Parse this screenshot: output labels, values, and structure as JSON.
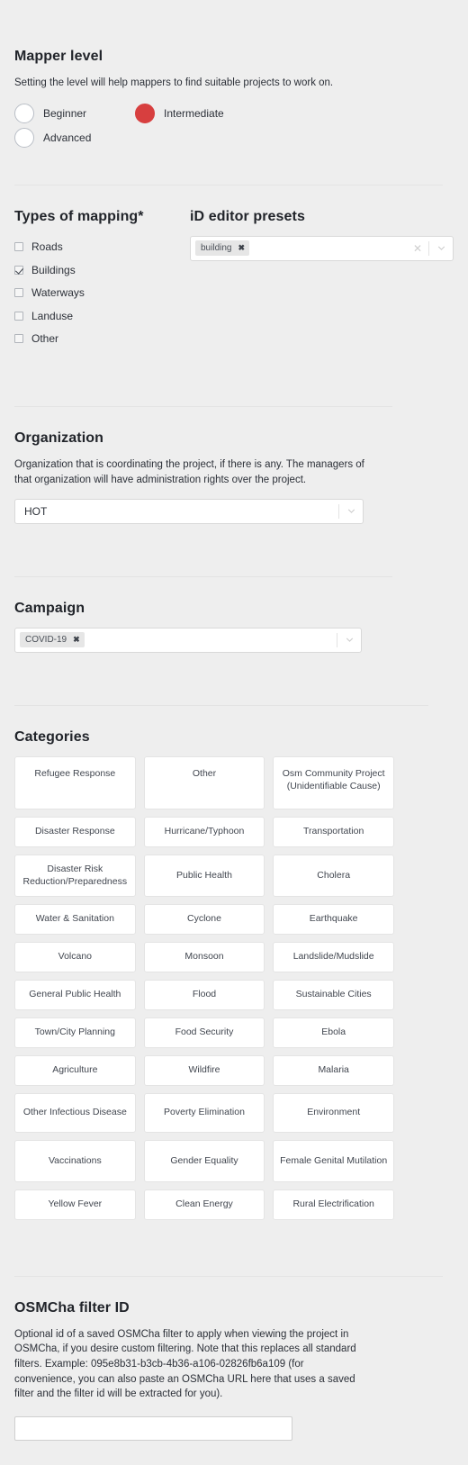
{
  "mapper_level": {
    "title": "Mapper level",
    "description": "Setting the level will help mappers to find suitable projects to work on.",
    "options": [
      {
        "label": "Beginner",
        "selected": false
      },
      {
        "label": "Intermediate",
        "selected": true
      },
      {
        "label": "Advanced",
        "selected": false
      }
    ],
    "selected_color": "#d73f3f"
  },
  "types_of_mapping": {
    "title": "Types of mapping*",
    "items": [
      {
        "label": "Roads",
        "checked": false
      },
      {
        "label": "Buildings",
        "checked": true
      },
      {
        "label": "Waterways",
        "checked": false
      },
      {
        "label": "Landuse",
        "checked": false
      },
      {
        "label": "Other",
        "checked": false
      }
    ]
  },
  "id_editor_presets": {
    "title": "iD editor presets",
    "tags": [
      {
        "label": "building",
        "remove": "✖"
      }
    ],
    "clear_glyph": "✕"
  },
  "organization": {
    "title": "Organization",
    "description": "Organization that is coordinating the project, if there is any. The managers of that organization will have administration rights over the project.",
    "value": "HOT"
  },
  "campaign": {
    "title": "Campaign",
    "tags": [
      {
        "label": "COVID-19",
        "remove": "✖"
      }
    ]
  },
  "categories": {
    "title": "Categories",
    "items": [
      "Refugee Response",
      "Other",
      "Osm Community Project (Unidentifiable Cause)",
      "Disaster Response",
      "Hurricane/Typhoon",
      "Transportation",
      "Disaster Risk Reduction/Preparedness",
      "Public Health",
      "Cholera",
      "Water & Sanitation",
      "Cyclone",
      "Earthquake",
      "Volcano",
      "Monsoon",
      "Landslide/Mudslide",
      "General Public Health",
      "Flood",
      "Sustainable Cities",
      "Town/City Planning",
      "Food Security",
      "Ebola",
      "Agriculture",
      "Wildfire",
      "Malaria",
      "Other Infectious Disease",
      "Poverty Elimination",
      "Environment",
      "Vaccinations",
      "Gender Equality",
      "Female Genital Mutilation",
      "Yellow Fever",
      "Clean Energy",
      "Rural Electrification"
    ]
  },
  "osmcha": {
    "title": "OSMCha filter ID",
    "description": "Optional id of a saved OSMCha filter to apply when viewing the project in OSMCha, if you desire custom filtering. Note that this replaces all standard filters. Example: 095e8b31-b3cb-4b36-a106-02826fb6a109 (for convenience, you can also paste an OSMCha URL here that uses a saved filter and the filter id will be extracted for you).",
    "value": "",
    "placeholder": ""
  }
}
